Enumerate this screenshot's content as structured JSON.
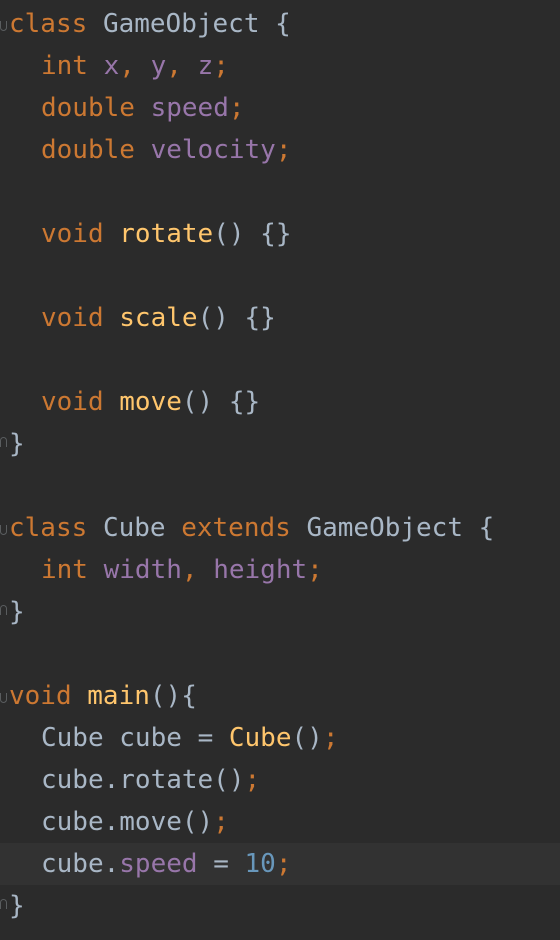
{
  "colors": {
    "background": "#2b2b2b",
    "current_line": "#323232",
    "keyword": "#cc7832",
    "function": "#ffc66d",
    "field": "#9876aa",
    "number": "#6897bb",
    "text": "#a9b7c6"
  },
  "code": {
    "l1": {
      "kw": "class",
      "name": "GameObject",
      "brace": "{"
    },
    "l2": {
      "type": "int",
      "x": "x",
      "c1": ",",
      "y": "y",
      "c2": ",",
      "z": "z",
      "semi": ";"
    },
    "l3": {
      "type": "double",
      "field": "speed",
      "semi": ";"
    },
    "l4": {
      "type": "double",
      "field": "velocity",
      "semi": ";"
    },
    "l6": {
      "kw": "void",
      "fn": "rotate",
      "rest": "() {}"
    },
    "l8": {
      "kw": "void",
      "fn": "scale",
      "rest": "() {}"
    },
    "l10": {
      "kw": "void",
      "fn": "move",
      "rest": "() {}"
    },
    "l11": {
      "brace": "}"
    },
    "l13": {
      "kw": "class",
      "name": "Cube",
      "ext": "extends",
      "parent": "GameObject",
      "brace": "{"
    },
    "l14": {
      "type": "int",
      "f1": "width",
      "c1": ",",
      "f2": "height",
      "semi": ";"
    },
    "l15": {
      "brace": "}"
    },
    "l17": {
      "kw": "void",
      "fn": "main",
      "rest": "(){"
    },
    "l18": {
      "type": "Cube",
      "var": "cube",
      "eq": "=",
      "ctor": "Cube",
      "paren": "()",
      "semi": ";"
    },
    "l19": {
      "call": "cube.rotate()",
      "semi": ";"
    },
    "l20": {
      "call": "cube.move()",
      "semi": ";"
    },
    "l21": {
      "obj": "cube.",
      "field": "speed",
      "eq": " = ",
      "num": "10",
      "semi": ";"
    },
    "l22": {
      "brace": "}"
    }
  }
}
